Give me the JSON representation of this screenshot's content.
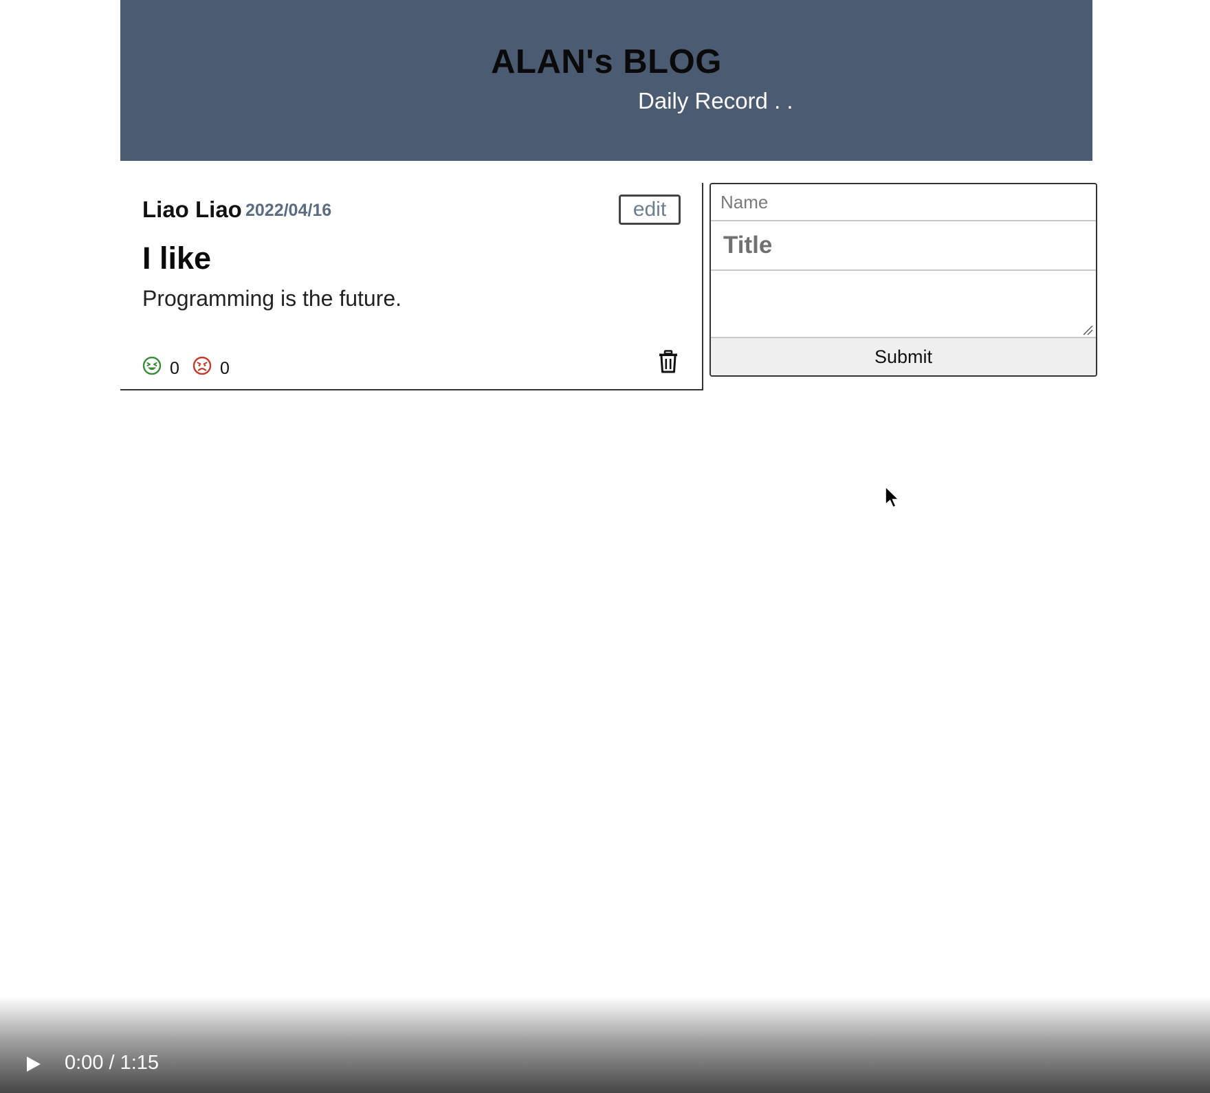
{
  "header": {
    "title": "ALAN's BLOG",
    "subtitle": "Daily Record . ."
  },
  "post": {
    "author": "Liao Liao",
    "date": "2022/04/16",
    "edit_label": "edit",
    "title": "I like",
    "body": "Programming is the future.",
    "likes": "0",
    "dislikes": "0",
    "like_icon": "laughing-face-icon",
    "dislike_icon": "angry-face-icon",
    "delete_icon": "trash-icon"
  },
  "form": {
    "name_placeholder": "Name",
    "title_placeholder": "Title",
    "content_value": "",
    "submit_label": "Submit"
  },
  "video": {
    "time": "0:00 / 1:15",
    "play_icon": "play-icon"
  },
  "colors": {
    "header_bg": "#4b5b71",
    "date_text": "#5b6b80",
    "like": "#3a8a3a",
    "dislike": "#c0392b"
  }
}
